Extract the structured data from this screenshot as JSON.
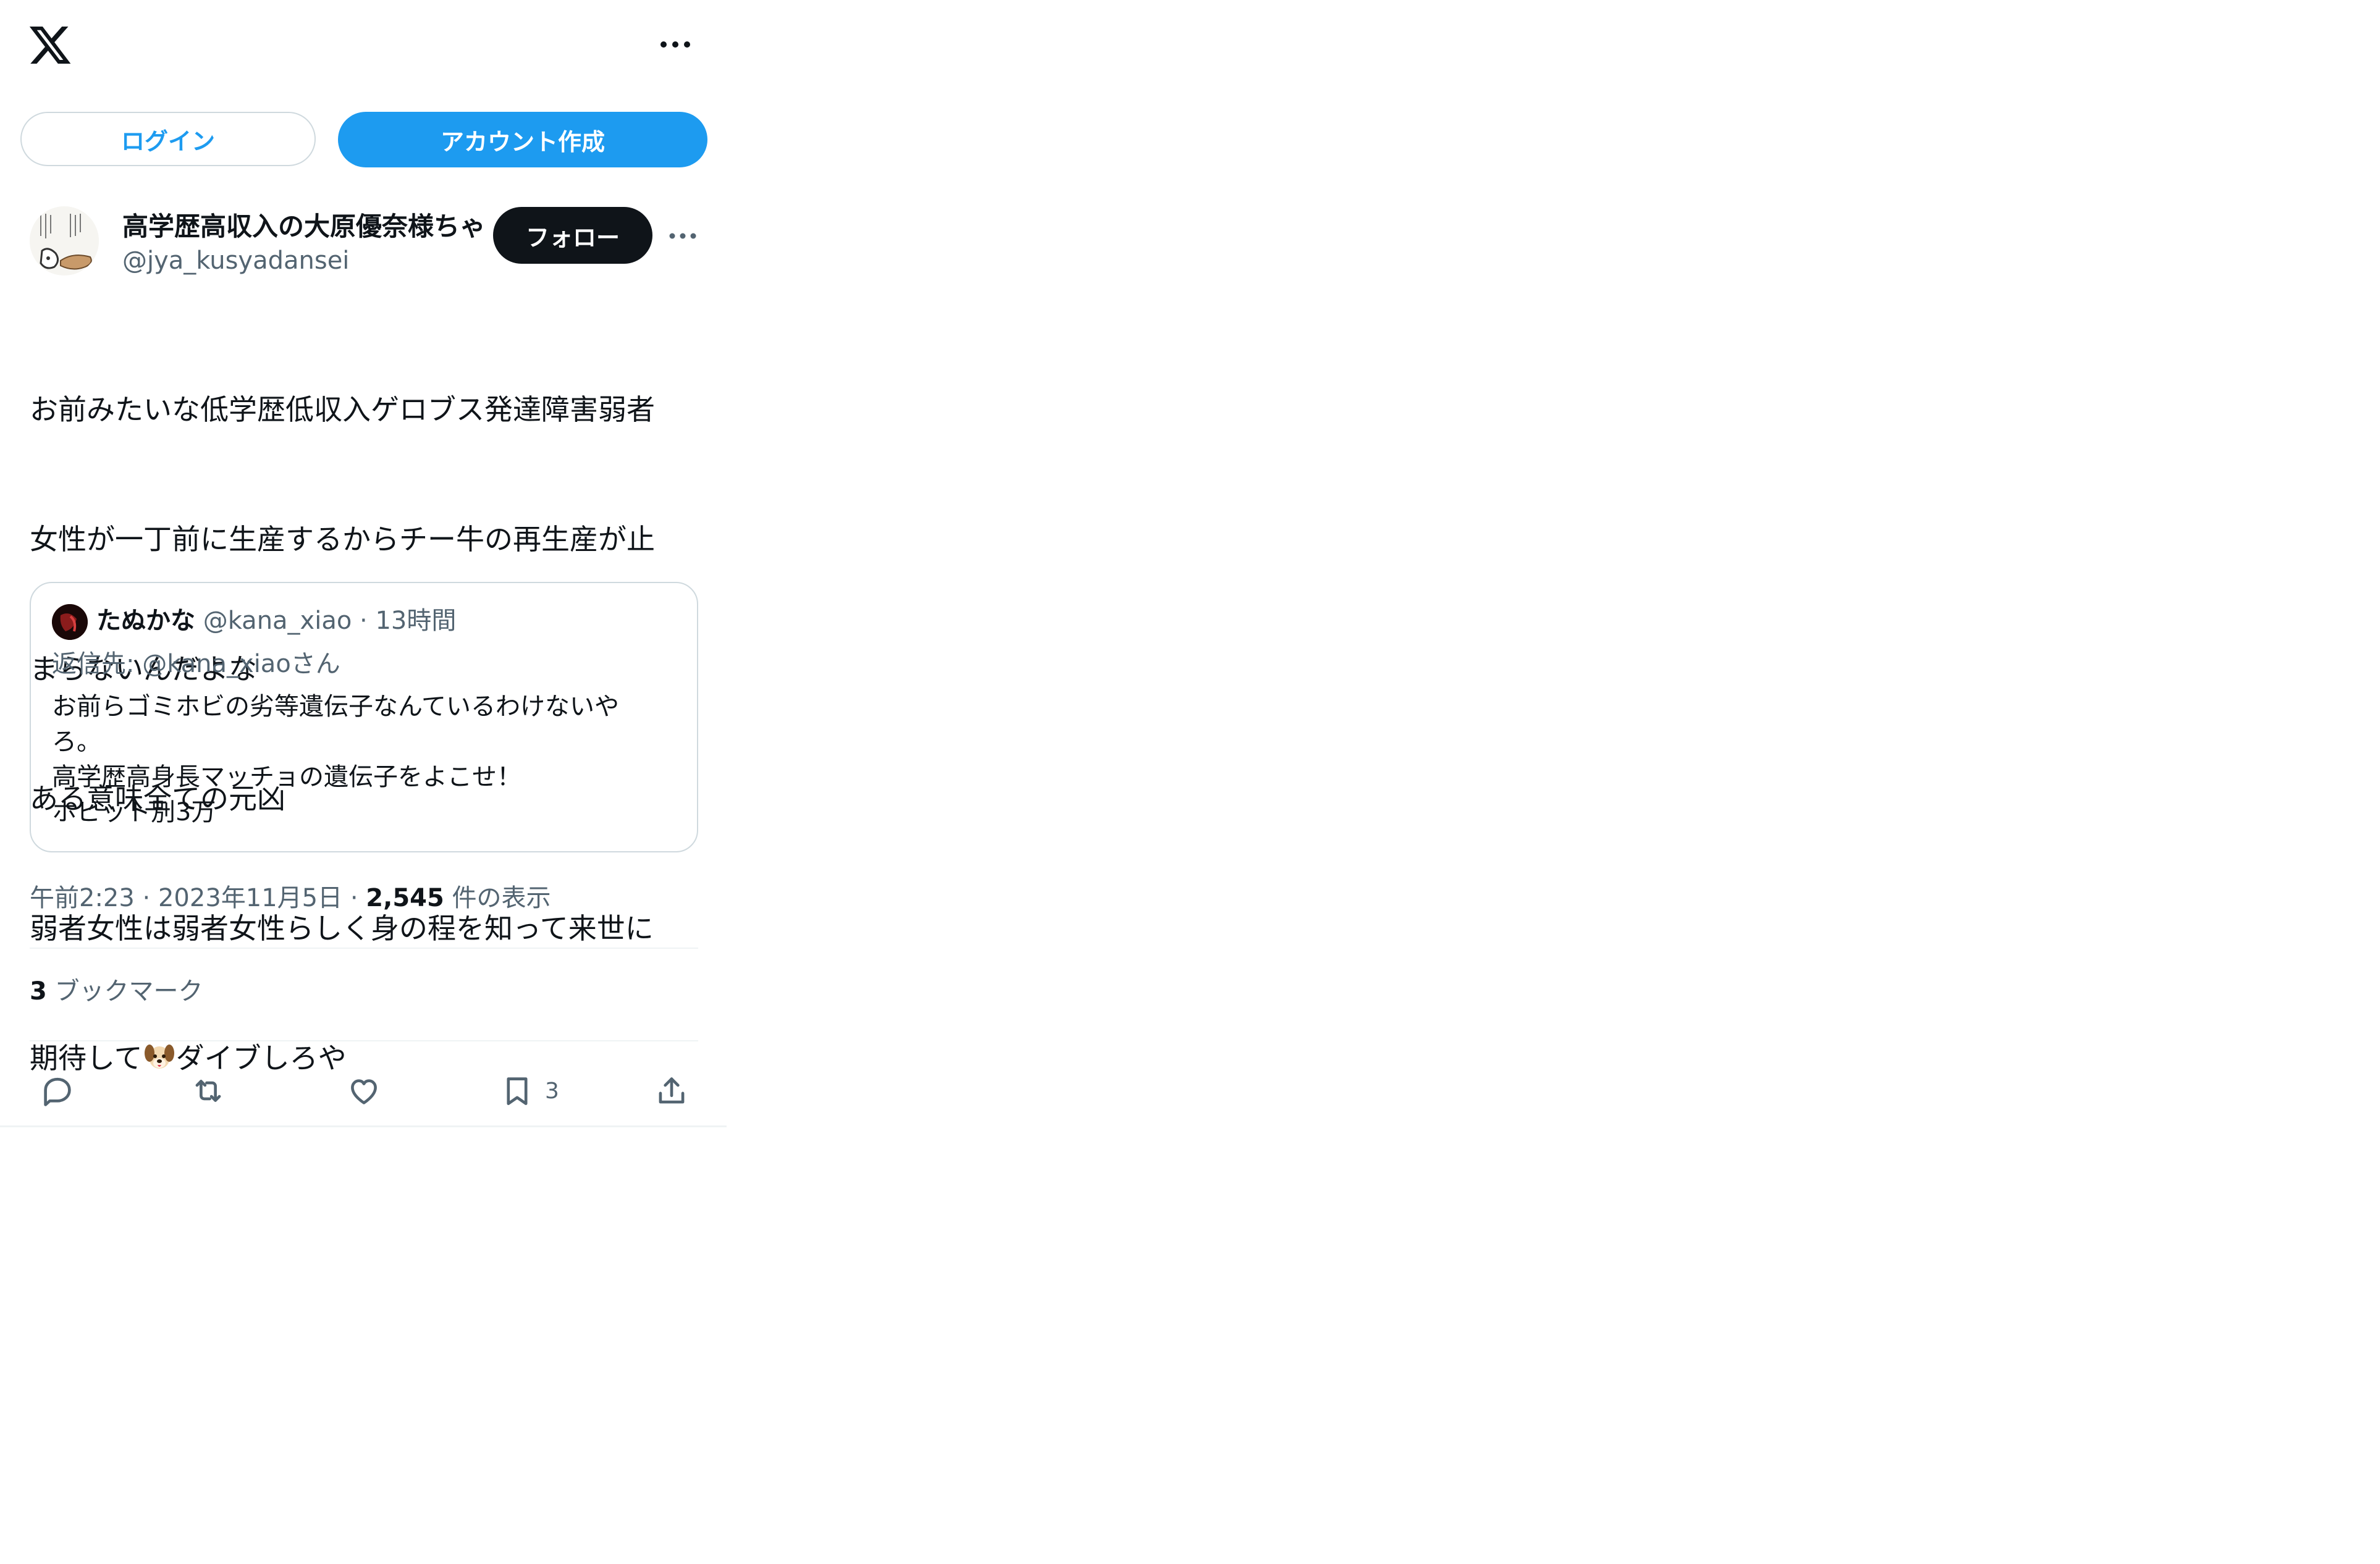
{
  "header": {
    "logo_icon": "x-logo-icon",
    "more_icon": "more-horizontal-icon"
  },
  "auth": {
    "login_label": "ログイン",
    "signup_label": "アカウント作成"
  },
  "tweet": {
    "author_name": "高学歴高収入の大原優奈様ちゃ",
    "author_handle": "@jya_kusyadansei",
    "follow_label": "フォロー",
    "text_lines": [
      "お前みたいな低学歴低収入ゲロブス発達障害弱者",
      "女性が一丁前に生産するからチー牛の再生産が止",
      "まらないんだよな",
      "ある意味全ての元凶",
      "弱者女性は弱者女性らしく身の程を知って来世に",
      "期待して",
      "ダイブしろや"
    ],
    "emoji_icon": "dog-face-icon",
    "quote": {
      "name": "たぬかな",
      "handle": "@kana_xiao",
      "dot": "·",
      "time": "13時間",
      "reply_to": "返信先: @kana_xiaoさん",
      "lines": [
        "お前らゴミホビの劣等遺伝子なんているわけないや",
        "ろ。",
        "高学歴高身長マッチョの遺伝子をよこせ！",
        "ホビット別3万"
      ]
    },
    "meta": {
      "time": "午前2:23",
      "sep1": "·",
      "date": "2023年11月5日",
      "sep2": "·",
      "views": "2,545",
      "views_label": "件の表示"
    },
    "bookmarks": {
      "count": "3",
      "label": "ブックマーク"
    },
    "actions": {
      "reply_icon": "reply-icon",
      "retweet_icon": "retweet-icon",
      "like_icon": "like-icon",
      "bookmark_icon": "bookmark-icon",
      "bookmark_count": "3",
      "share_icon": "share-icon"
    }
  },
  "colors": {
    "accent": "#1d9bf0",
    "text": "#0f1419",
    "secondary": "#536471",
    "border": "#cfd9de",
    "follow_bg": "#0f1419"
  }
}
